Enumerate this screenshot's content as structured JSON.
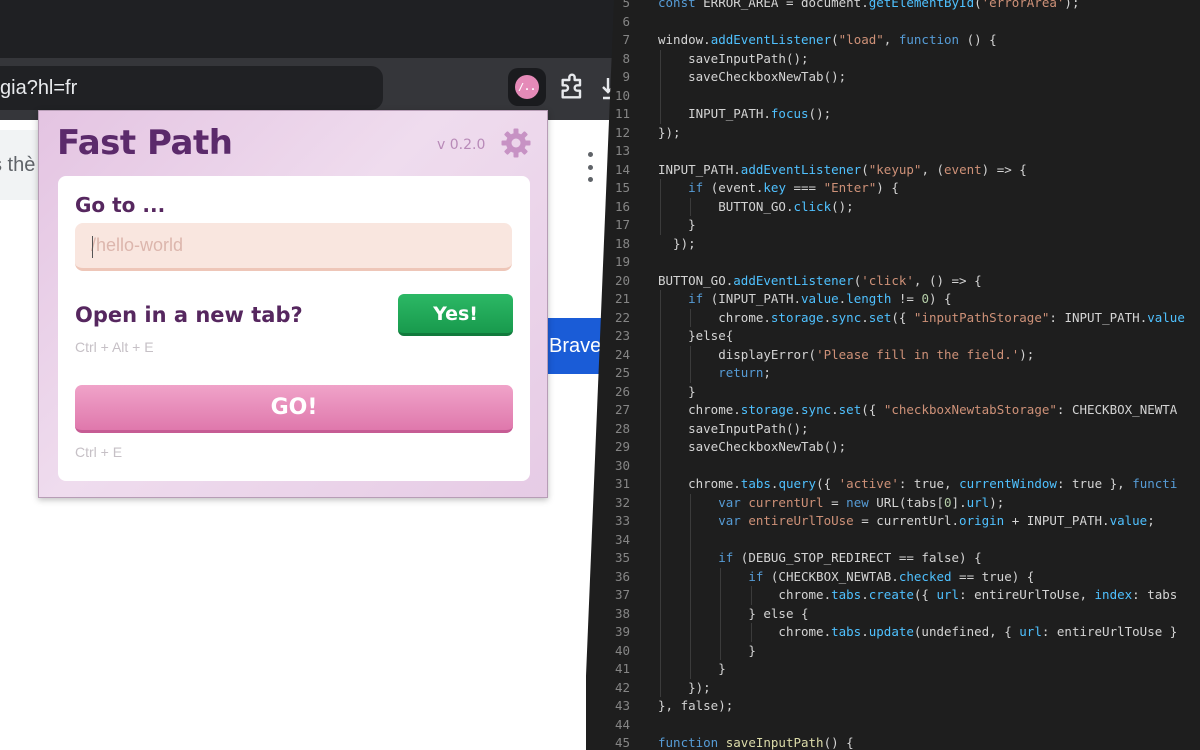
{
  "browser": {
    "url": "gia?hl=fr",
    "extension_icon_label": "/..",
    "page_partial_text": "s thè",
    "blue_button_text": "Brave"
  },
  "popup": {
    "title": "Fast Path",
    "version": "v 0.2.0",
    "goto_label": "Go to ...",
    "path_placeholder": "/hello-world",
    "newtab_label": "Open in a new tab?",
    "yes_label": "Yes!",
    "newtab_shortcut": "Ctrl + Alt + E",
    "go_label": "GO!",
    "go_shortcut": "Ctrl + E",
    "colors": {
      "title": "#5b2a6b",
      "yes_button": "#1fa855",
      "go_button": "#e48bb9"
    }
  },
  "code": {
    "lines": [
      {
        "n": "5",
        "indent": 0,
        "tokens": [
          [
            "const ",
            "#569cd6"
          ],
          [
            "ERROR_AREA",
            "#d4d4d4"
          ],
          [
            " = document.",
            "#d4d4d4"
          ],
          [
            "getElementById",
            "#4fc1ff"
          ],
          [
            "(",
            "#d4d4d4"
          ],
          [
            "'errorArea'",
            "#ce9178"
          ],
          [
            ");",
            "#d4d4d4"
          ]
        ]
      },
      {
        "n": "6",
        "indent": 0,
        "tokens": []
      },
      {
        "n": "7",
        "indent": 0,
        "tokens": [
          [
            "window.",
            "#d4d4d4"
          ],
          [
            "addEventListener",
            "#4fc1ff"
          ],
          [
            "(",
            "#d4d4d4"
          ],
          [
            "\"load\"",
            "#ce9178"
          ],
          [
            ", ",
            "#d4d4d4"
          ],
          [
            "function",
            "#569cd6"
          ],
          [
            " () {",
            "#d4d4d4"
          ]
        ]
      },
      {
        "n": "8",
        "indent": 1,
        "tokens": [
          [
            "saveInputPath();",
            "#d4d4d4"
          ]
        ]
      },
      {
        "n": "9",
        "indent": 1,
        "tokens": [
          [
            "saveCheckboxNewTab();",
            "#d4d4d4"
          ]
        ]
      },
      {
        "n": "10",
        "indent": 1,
        "tokens": []
      },
      {
        "n": "11",
        "indent": 1,
        "tokens": [
          [
            "INPUT_PATH.",
            "#d4d4d4"
          ],
          [
            "focus",
            "#4fc1ff"
          ],
          [
            "();",
            "#d4d4d4"
          ]
        ]
      },
      {
        "n": "12",
        "indent": 0,
        "tokens": [
          [
            "});",
            "#d4d4d4"
          ]
        ]
      },
      {
        "n": "13",
        "indent": 0,
        "tokens": []
      },
      {
        "n": "14",
        "indent": 0,
        "tokens": [
          [
            "INPUT_PATH.",
            "#d4d4d4"
          ],
          [
            "addEventListener",
            "#4fc1ff"
          ],
          [
            "(",
            "#d4d4d4"
          ],
          [
            "\"keyup\"",
            "#ce9178"
          ],
          [
            ", (",
            "#d4d4d4"
          ],
          [
            "event",
            "#ce9178"
          ],
          [
            ") => {",
            "#d4d4d4"
          ]
        ]
      },
      {
        "n": "15",
        "indent": 1,
        "tokens": [
          [
            "if",
            "#569cd6"
          ],
          [
            " (event.",
            "#d4d4d4"
          ],
          [
            "key",
            "#4fc1ff"
          ],
          [
            " === ",
            "#d4d4d4"
          ],
          [
            "\"Enter\"",
            "#ce9178"
          ],
          [
            ") {",
            "#d4d4d4"
          ]
        ]
      },
      {
        "n": "16",
        "indent": 2,
        "tokens": [
          [
            "BUTTON_GO.",
            "#d4d4d4"
          ],
          [
            "click",
            "#4fc1ff"
          ],
          [
            "();",
            "#d4d4d4"
          ]
        ]
      },
      {
        "n": "17",
        "indent": 1,
        "tokens": [
          [
            "}",
            "#d4d4d4"
          ]
        ]
      },
      {
        "n": "18",
        "indent": 0,
        "tokens": [
          [
            "  });",
            "#d4d4d4"
          ]
        ]
      },
      {
        "n": "19",
        "indent": 0,
        "tokens": []
      },
      {
        "n": "20",
        "indent": 0,
        "tokens": [
          [
            "BUTTON_GO.",
            "#d4d4d4"
          ],
          [
            "addEventListener",
            "#4fc1ff"
          ],
          [
            "(",
            "#d4d4d4"
          ],
          [
            "'click'",
            "#ce9178"
          ],
          [
            ", () => {",
            "#d4d4d4"
          ]
        ]
      },
      {
        "n": "21",
        "indent": 1,
        "tokens": [
          [
            "if",
            "#569cd6"
          ],
          [
            " (INPUT_PATH.",
            "#d4d4d4"
          ],
          [
            "value",
            "#4fc1ff"
          ],
          [
            ".",
            "#d4d4d4"
          ],
          [
            "length",
            "#4fc1ff"
          ],
          [
            " != ",
            "#d4d4d4"
          ],
          [
            "0",
            "#b5cea8"
          ],
          [
            ") {",
            "#d4d4d4"
          ]
        ]
      },
      {
        "n": "22",
        "indent": 2,
        "tokens": [
          [
            "chrome.",
            "#d4d4d4"
          ],
          [
            "storage",
            "#4fc1ff"
          ],
          [
            ".",
            "#d4d4d4"
          ],
          [
            "sync",
            "#4fc1ff"
          ],
          [
            ".",
            "#d4d4d4"
          ],
          [
            "set",
            "#4fc1ff"
          ],
          [
            "({ ",
            "#d4d4d4"
          ],
          [
            "\"inputPathStorage\"",
            "#ce9178"
          ],
          [
            ": INPUT_PATH.",
            "#d4d4d4"
          ],
          [
            "value",
            "#4fc1ff"
          ]
        ]
      },
      {
        "n": "23",
        "indent": 1,
        "tokens": [
          [
            "}else{",
            "#d4d4d4"
          ]
        ]
      },
      {
        "n": "24",
        "indent": 2,
        "tokens": [
          [
            "displayError(",
            "#d4d4d4"
          ],
          [
            "'Please fill in the field.'",
            "#ce9178"
          ],
          [
            ");",
            "#d4d4d4"
          ]
        ]
      },
      {
        "n": "25",
        "indent": 2,
        "tokens": [
          [
            "return",
            "#569cd6"
          ],
          [
            ";",
            "#d4d4d4"
          ]
        ]
      },
      {
        "n": "26",
        "indent": 1,
        "tokens": [
          [
            "}",
            "#d4d4d4"
          ]
        ]
      },
      {
        "n": "27",
        "indent": 1,
        "tokens": [
          [
            "chrome.",
            "#d4d4d4"
          ],
          [
            "storage",
            "#4fc1ff"
          ],
          [
            ".",
            "#d4d4d4"
          ],
          [
            "sync",
            "#4fc1ff"
          ],
          [
            ".",
            "#d4d4d4"
          ],
          [
            "set",
            "#4fc1ff"
          ],
          [
            "({ ",
            "#d4d4d4"
          ],
          [
            "\"checkboxNewtabStorage\"",
            "#ce9178"
          ],
          [
            ": CHECKBOX_NEWTA",
            "#d4d4d4"
          ]
        ]
      },
      {
        "n": "28",
        "indent": 1,
        "tokens": [
          [
            "saveInputPath();",
            "#d4d4d4"
          ]
        ]
      },
      {
        "n": "29",
        "indent": 1,
        "tokens": [
          [
            "saveCheckboxNewTab();",
            "#d4d4d4"
          ]
        ]
      },
      {
        "n": "30",
        "indent": 1,
        "tokens": []
      },
      {
        "n": "31",
        "indent": 1,
        "tokens": [
          [
            "chrome.",
            "#d4d4d4"
          ],
          [
            "tabs",
            "#4fc1ff"
          ],
          [
            ".",
            "#d4d4d4"
          ],
          [
            "query",
            "#4fc1ff"
          ],
          [
            "({ ",
            "#d4d4d4"
          ],
          [
            "'active'",
            "#ce9178"
          ],
          [
            ": true, ",
            "#d4d4d4"
          ],
          [
            "currentWindow",
            "#4fc1ff"
          ],
          [
            ": true }, ",
            "#d4d4d4"
          ],
          [
            "functi",
            "#569cd6"
          ]
        ]
      },
      {
        "n": "32",
        "indent": 2,
        "tokens": [
          [
            "var",
            "#569cd6"
          ],
          [
            " ",
            "#d4d4d4"
          ],
          [
            "currentUrl",
            "#ce9178"
          ],
          [
            " = ",
            "#d4d4d4"
          ],
          [
            "new",
            "#569cd6"
          ],
          [
            " URL(tabs[",
            "#d4d4d4"
          ],
          [
            "0",
            "#b5cea8"
          ],
          [
            "].",
            "#d4d4d4"
          ],
          [
            "url",
            "#4fc1ff"
          ],
          [
            ");",
            "#d4d4d4"
          ]
        ]
      },
      {
        "n": "33",
        "indent": 2,
        "tokens": [
          [
            "var",
            "#569cd6"
          ],
          [
            " ",
            "#d4d4d4"
          ],
          [
            "entireUrlToUse",
            "#ce9178"
          ],
          [
            " = currentUrl.",
            "#d4d4d4"
          ],
          [
            "origin",
            "#4fc1ff"
          ],
          [
            " + INPUT_PATH.",
            "#d4d4d4"
          ],
          [
            "value",
            "#4fc1ff"
          ],
          [
            ";",
            "#d4d4d4"
          ]
        ]
      },
      {
        "n": "34",
        "indent": 2,
        "tokens": []
      },
      {
        "n": "35",
        "indent": 2,
        "tokens": [
          [
            "if",
            "#569cd6"
          ],
          [
            " (DEBUG_STOP_REDIRECT == false) {",
            "#d4d4d4"
          ]
        ]
      },
      {
        "n": "36",
        "indent": 3,
        "tokens": [
          [
            "if",
            "#569cd6"
          ],
          [
            " (CHECKBOX_NEWTAB.",
            "#d4d4d4"
          ],
          [
            "checked",
            "#4fc1ff"
          ],
          [
            " == true) {",
            "#d4d4d4"
          ]
        ]
      },
      {
        "n": "37",
        "indent": 4,
        "tokens": [
          [
            "chrome.",
            "#d4d4d4"
          ],
          [
            "tabs",
            "#4fc1ff"
          ],
          [
            ".",
            "#d4d4d4"
          ],
          [
            "create",
            "#4fc1ff"
          ],
          [
            "({ ",
            "#d4d4d4"
          ],
          [
            "url",
            "#4fc1ff"
          ],
          [
            ": entireUrlToUse, ",
            "#d4d4d4"
          ],
          [
            "index",
            "#4fc1ff"
          ],
          [
            ": tabs",
            "#d4d4d4"
          ]
        ]
      },
      {
        "n": "38",
        "indent": 3,
        "tokens": [
          [
            "} else {",
            "#d4d4d4"
          ]
        ]
      },
      {
        "n": "39",
        "indent": 4,
        "tokens": [
          [
            "chrome.",
            "#d4d4d4"
          ],
          [
            "tabs",
            "#4fc1ff"
          ],
          [
            ".",
            "#d4d4d4"
          ],
          [
            "update",
            "#4fc1ff"
          ],
          [
            "(undefined, { ",
            "#d4d4d4"
          ],
          [
            "url",
            "#4fc1ff"
          ],
          [
            ": entireUrlToUse }",
            "#d4d4d4"
          ]
        ]
      },
      {
        "n": "40",
        "indent": 3,
        "tokens": [
          [
            "}",
            "#d4d4d4"
          ]
        ]
      },
      {
        "n": "41",
        "indent": 2,
        "tokens": [
          [
            "}",
            "#d4d4d4"
          ]
        ]
      },
      {
        "n": "42",
        "indent": 1,
        "tokens": [
          [
            "});",
            "#d4d4d4"
          ]
        ]
      },
      {
        "n": "43",
        "indent": 0,
        "tokens": [
          [
            "}, false);",
            "#d4d4d4"
          ]
        ]
      },
      {
        "n": "44",
        "indent": 0,
        "tokens": []
      },
      {
        "n": "45",
        "indent": 0,
        "tokens": [
          [
            "function",
            "#569cd6"
          ],
          [
            " ",
            "#d4d4d4"
          ],
          [
            "saveInputPath",
            "#dcdcaa"
          ],
          [
            "() {",
            "#d4d4d4"
          ]
        ]
      }
    ]
  }
}
